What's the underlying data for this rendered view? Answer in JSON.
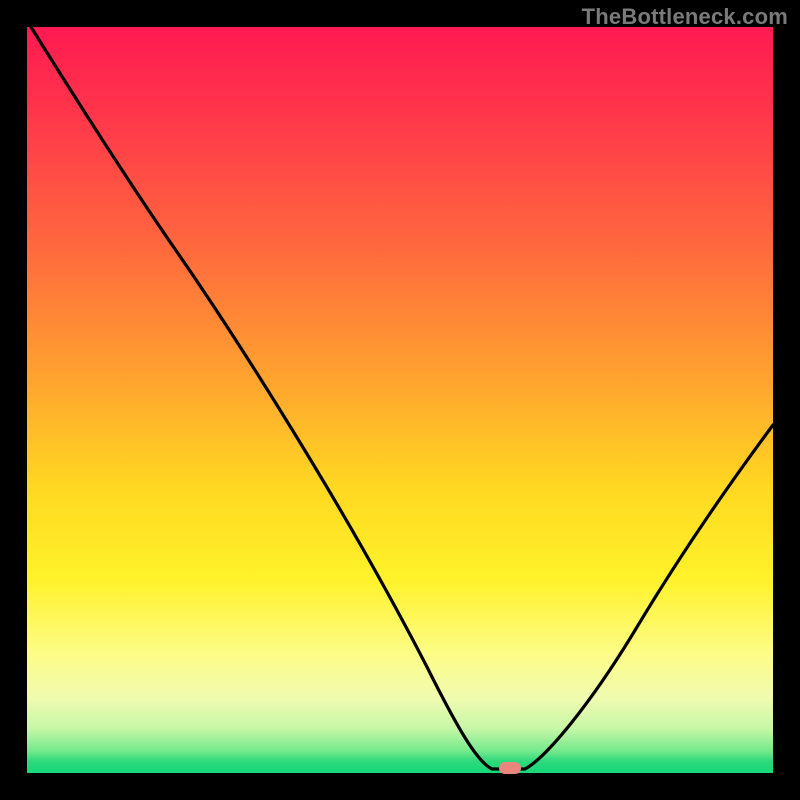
{
  "watermark": "TheBottleneck.com",
  "marker": {
    "color": "#e9857d"
  },
  "curve_color": "#000000",
  "chart_data": {
    "type": "line",
    "title": "",
    "xlabel": "",
    "ylabel": "",
    "xlim": [
      0,
      100
    ],
    "ylim": [
      0,
      100
    ],
    "x": [
      0,
      5,
      10,
      15,
      20,
      25,
      30,
      35,
      40,
      45,
      50,
      55,
      57,
      60,
      62,
      64,
      66,
      70,
      75,
      80,
      85,
      90,
      95,
      100
    ],
    "values": [
      100,
      92,
      84,
      76,
      70,
      62,
      53,
      44,
      35,
      26,
      17,
      9,
      5,
      2,
      1,
      0,
      0,
      4,
      11,
      19,
      27,
      34,
      41,
      47
    ],
    "marker_point": {
      "x": 65,
      "y": 0
    },
    "gradient_stops": [
      {
        "pos": 0,
        "color": "#ff1a52"
      },
      {
        "pos": 0.12,
        "color": "#ff374b"
      },
      {
        "pos": 0.3,
        "color": "#ff6a3d"
      },
      {
        "pos": 0.48,
        "color": "#ffa62e"
      },
      {
        "pos": 0.62,
        "color": "#ffd921"
      },
      {
        "pos": 0.74,
        "color": "#fff22a"
      },
      {
        "pos": 0.84,
        "color": "#fdfc87"
      },
      {
        "pos": 0.9,
        "color": "#f0fbb0"
      },
      {
        "pos": 0.94,
        "color": "#c7f7a6"
      },
      {
        "pos": 0.97,
        "color": "#76e98d"
      },
      {
        "pos": 0.985,
        "color": "#2bd97c"
      },
      {
        "pos": 1.0,
        "color": "#16d877"
      }
    ]
  }
}
